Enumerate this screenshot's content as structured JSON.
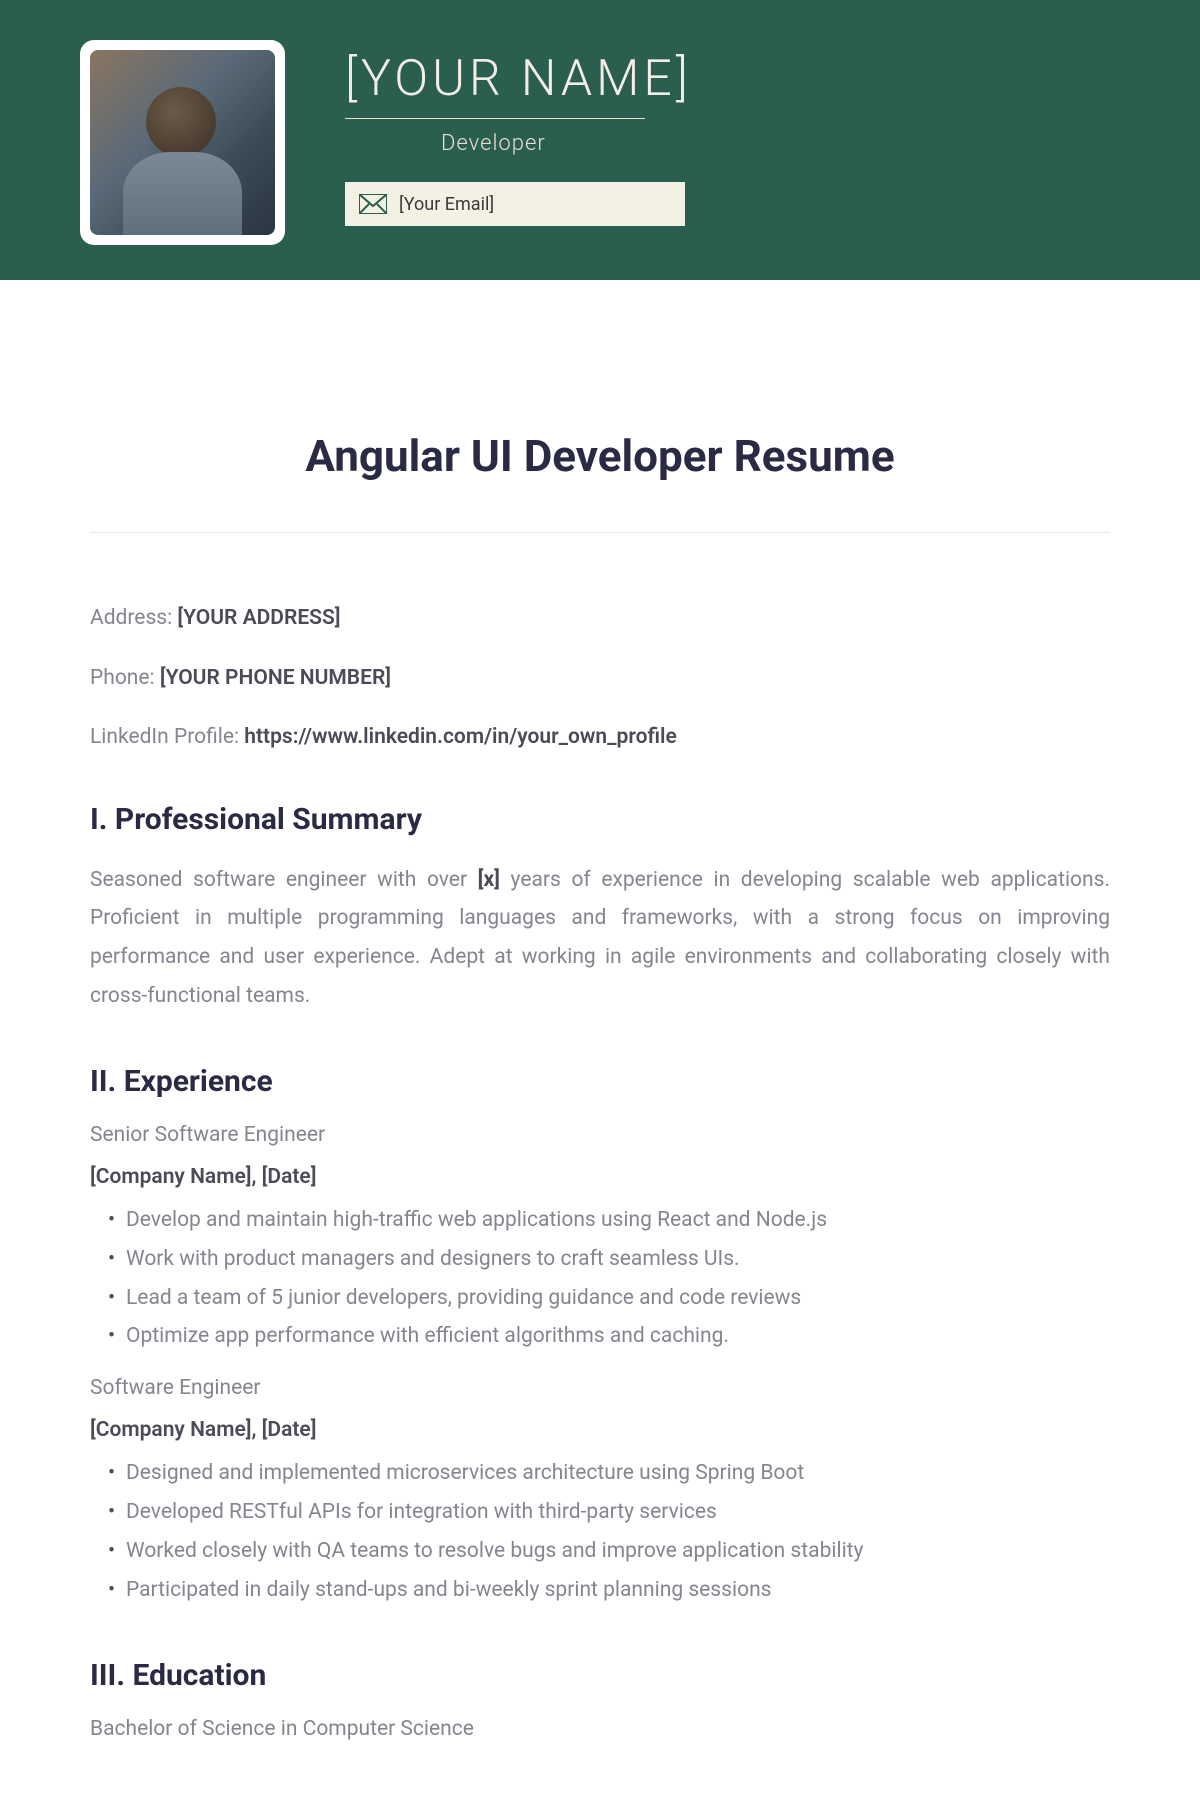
{
  "header": {
    "name": "[YOUR NAME]",
    "role": "Developer",
    "email_placeholder": "[Your Email]"
  },
  "title": "Angular UI Developer Resume",
  "contact": {
    "address_label": "Address: ",
    "address_value": "[YOUR ADDRESS]",
    "phone_label": "Phone: ",
    "phone_value": "[YOUR PHONE NUMBER]",
    "linkedin_label": "LinkedIn Profile: ",
    "linkedin_value": "https://www.linkedin.com/in/your_own_profile"
  },
  "sections": {
    "summary_heading": "I. Professional Summary",
    "summary_text_pre": "Seasoned software engineer with over ",
    "summary_text_bold": "[x]",
    "summary_text_post": " years of experience in developing scalable web applications. Proficient in multiple programming languages and frameworks, with a strong focus on improving performance and user experience. Adept at working in agile environments and collaborating closely with cross-functional teams.",
    "experience_heading": "II. Experience",
    "education_heading": "III. Education"
  },
  "experience": [
    {
      "title": "Senior Software Engineer",
      "meta": "[Company Name], [Date]",
      "bullets": [
        "Develop and maintain high-traffic web applications using React and Node.js",
        "Work with product managers and designers to craft seamless UIs.",
        "Lead a team of 5 junior developers, providing guidance and code reviews",
        "Optimize app performance with efficient algorithms and caching."
      ]
    },
    {
      "title": "Software Engineer",
      "meta": "[Company Name], [Date]",
      "bullets": [
        "Designed and implemented microservices architecture using Spring Boot",
        "Developed RESTful APIs for integration with third-party services",
        "Worked closely with QA teams to resolve bugs and improve application stability",
        "Participated in daily stand-ups and bi-weekly sprint planning sessions"
      ]
    }
  ],
  "education": {
    "degree": "Bachelor of Science in Computer Science"
  }
}
